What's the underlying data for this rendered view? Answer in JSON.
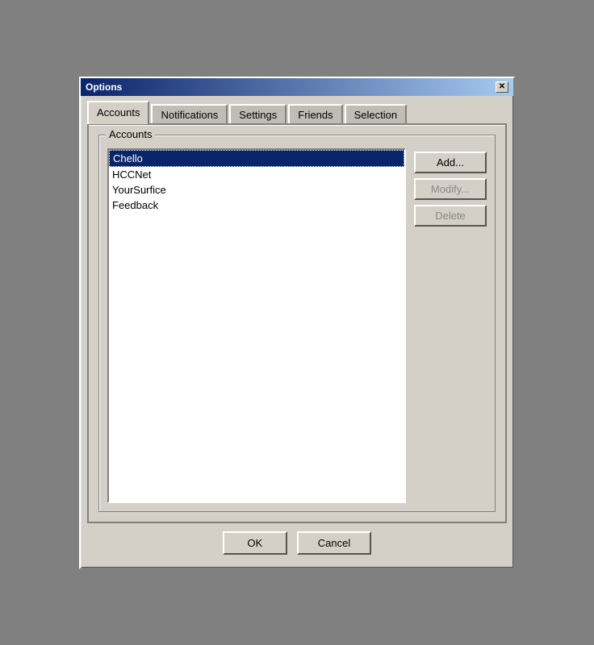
{
  "window": {
    "title": "Options",
    "close_label": "✕"
  },
  "tabs": [
    {
      "label": "Accounts",
      "active": true
    },
    {
      "label": "Notifications",
      "active": false
    },
    {
      "label": "Settings",
      "active": false
    },
    {
      "label": "Friends",
      "active": false
    },
    {
      "label": "Selection",
      "active": false
    }
  ],
  "accounts_tab": {
    "group_label": "Accounts",
    "accounts": [
      {
        "name": "Chello",
        "selected": true
      },
      {
        "name": "HCCNet",
        "selected": false
      },
      {
        "name": "YourSurfice",
        "selected": false
      },
      {
        "name": "Feedback",
        "selected": false
      }
    ],
    "buttons": {
      "add": "Add...",
      "modify": "Modify...",
      "delete": "Delete"
    }
  },
  "footer": {
    "ok": "OK",
    "cancel": "Cancel"
  }
}
